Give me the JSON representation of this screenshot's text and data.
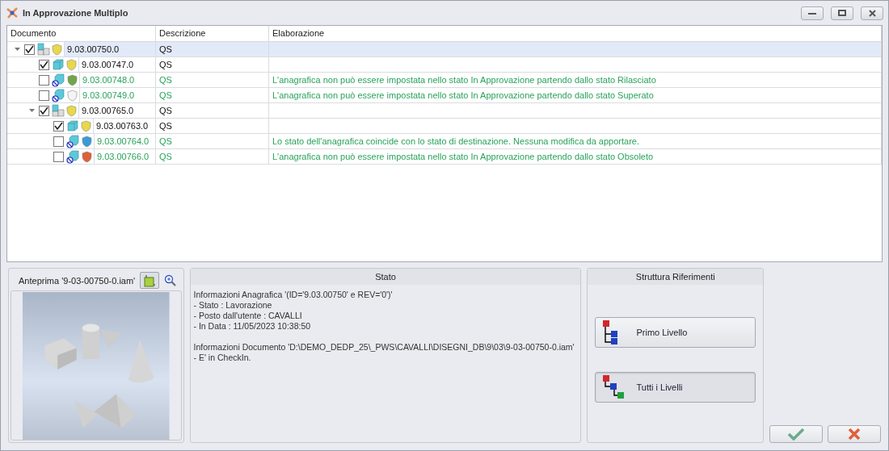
{
  "window": {
    "title": "In Approvazione Multiplo"
  },
  "tree": {
    "columns": [
      "Documento",
      "Descrizione",
      "Elaborazione"
    ],
    "rows": [
      {
        "code": "9.03.00750.0",
        "description": "QS",
        "checked": true,
        "expanded": true,
        "selected": true,
        "kind": "assembly",
        "blocked": false,
        "skipped": false,
        "color": "#e8d84a",
        "children": [
          {
            "code": "9.03.00747.0",
            "description": "QS",
            "checked": true,
            "selected": false,
            "kind": "part",
            "blocked": false,
            "skipped": false,
            "color": "#e8d84a"
          },
          {
            "code": "9.03.00748.0",
            "description": "QS",
            "elaboration": "L'anagrafica non può essere impostata nello stato In Approvazione partendo dallo stato Rilasciato",
            "checked": false,
            "selected": false,
            "kind": "part",
            "blocked": true,
            "skipped": true,
            "color": "#6fa64a"
          },
          {
            "code": "9.03.00749.0",
            "description": "QS",
            "elaboration": "L'anagrafica non può essere impostata nello stato In Approvazione partendo dallo stato Superato",
            "checked": false,
            "selected": false,
            "kind": "part",
            "blocked": true,
            "skipped": true,
            "color": "#f4f4f4"
          },
          {
            "code": "9.03.00765.0",
            "description": "QS",
            "checked": true,
            "expanded": true,
            "selected": false,
            "kind": "assembly",
            "blocked": false,
            "skipped": false,
            "color": "#e8d84a",
            "children": [
              {
                "code": "9.03.00763.0",
                "description": "QS",
                "checked": true,
                "selected": false,
                "kind": "part",
                "blocked": false,
                "skipped": false,
                "color": "#e8d84a"
              },
              {
                "code": "9.03.00764.0",
                "description": "QS",
                "elaboration": "Lo stato dell'anagrafica coincide con lo stato di destinazione. Nessuna modifica da apportare.",
                "checked": false,
                "selected": false,
                "kind": "part",
                "blocked": true,
                "skipped": true,
                "color": "#3a9ad8"
              },
              {
                "code": "9.03.00766.0",
                "description": "QS",
                "elaboration": "L'anagrafica non può essere impostata nello stato In Approvazione partendo dallo stato Obsoleto",
                "checked": false,
                "selected": false,
                "kind": "part",
                "blocked": true,
                "skipped": true,
                "color": "#e0603a"
              }
            ]
          }
        ]
      }
    ]
  },
  "preview": {
    "title": "Anteprima '9-03-00750-0.iam'",
    "kind": "picture"
  },
  "status": {
    "title": "Stato",
    "sections": [
      [
        "Informazioni Anagrafica '(ID='9.03.00750' e REV='0')'",
        "- Stato : Lavorazione",
        "- Posto dall'utente : CAVALLI",
        "- In Data : 11/05/2023 10:38:50"
      ],
      [
        "Informazioni Documento 'D:\\DEMO_DEDP_25\\_PWS\\CAVALLI\\DISEGNI_DB\\9\\03\\9-03-00750-0.iam'",
        "- E' in CheckIn."
      ]
    ]
  },
  "references": {
    "title": "Struttura Riferimenti",
    "buttons": [
      {
        "label": "Primo Livello",
        "kind": "first",
        "selected": false
      },
      {
        "label": "Tutti i Livelli",
        "kind": "all",
        "selected": true
      }
    ]
  }
}
